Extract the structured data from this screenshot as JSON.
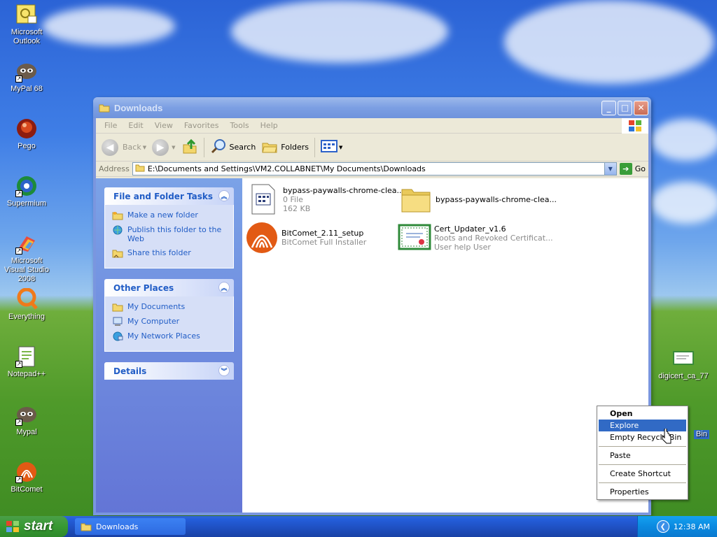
{
  "desktop": {
    "icons": [
      {
        "label": "Microsoft Outlook",
        "icon": "outlook-icon"
      },
      {
        "label": "MyPal 68",
        "icon": "mypal-icon"
      },
      {
        "label": "Pego",
        "icon": "pego-icon"
      },
      {
        "label": "Supermium",
        "icon": "supermium-icon"
      },
      {
        "label": "Microsoft Visual Studio 2008",
        "icon": "visual-studio-icon"
      },
      {
        "label": "Everything",
        "icon": "everything-icon"
      },
      {
        "label": "Notepad++",
        "icon": "notepadpp-icon"
      },
      {
        "label": "Mypal",
        "icon": "mypal-icon"
      },
      {
        "label": "BitComet",
        "icon": "bitcomet-icon"
      },
      {
        "label": "digicert_ca_77",
        "icon": "certificate-icon"
      },
      {
        "label": "Bin",
        "icon": "recycle-bin-icon"
      }
    ]
  },
  "window": {
    "title": "Downloads",
    "menu": [
      "File",
      "Edit",
      "View",
      "Favorites",
      "Tools",
      "Help"
    ],
    "toolbar": {
      "back": "Back",
      "search": "Search",
      "folders": "Folders"
    },
    "address": {
      "label": "Address",
      "value": "E:\\Documents and Settings\\VM2.COLLABNET\\My Documents\\Downloads",
      "go": "Go"
    },
    "taskpane": {
      "file_tasks": {
        "title": "File and Folder Tasks",
        "items": [
          "Make a new folder",
          "Publish this folder to the Web",
          "Share this folder"
        ]
      },
      "other_places": {
        "title": "Other Places",
        "items": [
          "My Documents",
          "My Computer",
          "My Network Places"
        ]
      },
      "details": {
        "title": "Details"
      }
    },
    "files": [
      {
        "name": "bypass-paywalls-chrome-clea...",
        "line2": "0 File",
        "line3": "162 KB",
        "icon": "archive-file-icon"
      },
      {
        "name": "bypass-paywalls-chrome-clea...",
        "line2": "",
        "line3": "",
        "icon": "folder-icon"
      },
      {
        "name": "BitComet_2.11_setup",
        "line2": "BitComet Full Installer",
        "line3": "",
        "icon": "bitcomet-installer-icon"
      },
      {
        "name": "Cert_Updater_v1.6",
        "line2": "Roots and Revoked Certificat...",
        "line3": "User help User",
        "icon": "certificate-icon"
      }
    ]
  },
  "context_menu": {
    "items": [
      "Open",
      "Explore",
      "Empty Recycle Bin",
      "Paste",
      "Create Shortcut",
      "Properties"
    ],
    "default_item": "Open",
    "highlighted_item": "Explore"
  },
  "taskbar": {
    "start_label": "start",
    "task_button": "Downloads",
    "clock": "12:38 AM"
  },
  "colors": {
    "xp_blue": "#0a46d6",
    "taskpane_link": "#215dc6",
    "menu_highlight": "#316ac5",
    "start_green": "#379932"
  }
}
